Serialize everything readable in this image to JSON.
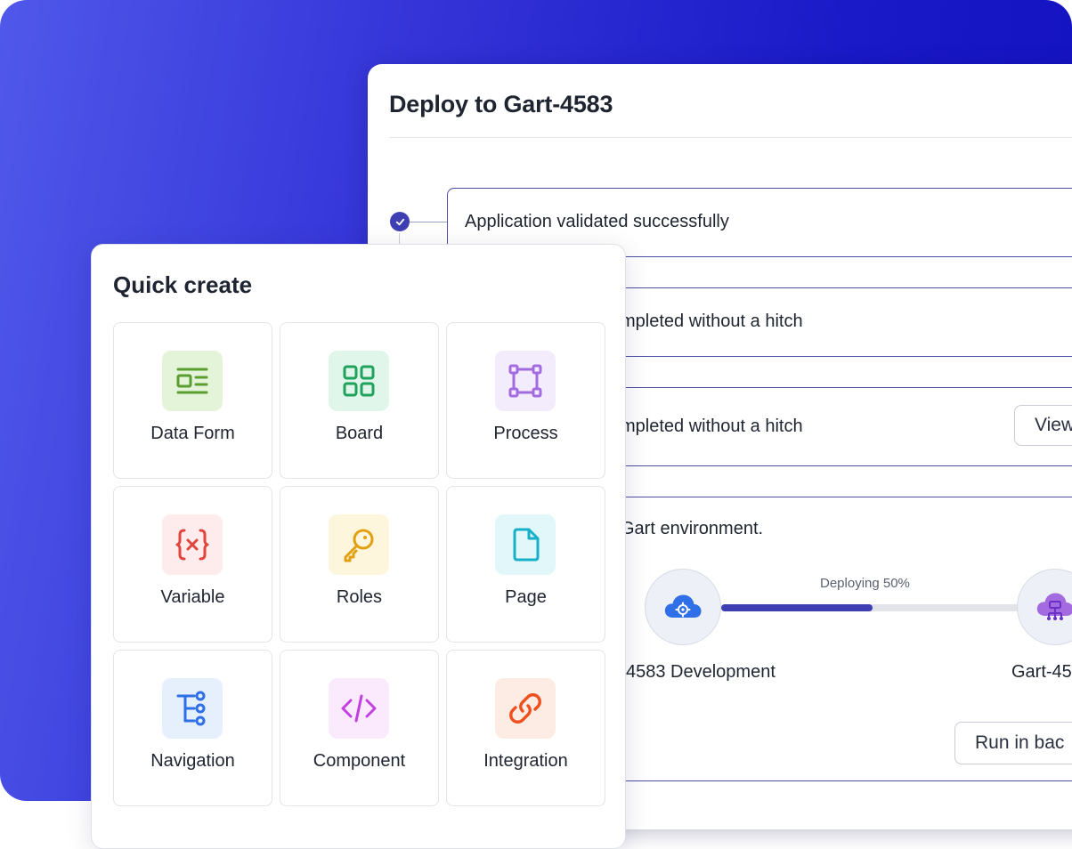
{
  "deploy": {
    "title": "Deploy to Gart-4583",
    "steps": [
      {
        "text": "Application validated successfully"
      },
      {
        "text": "mpleted without a hitch"
      },
      {
        "text": "mpleted without a hitch",
        "button": "View"
      },
      {
        "text": "Gart environment."
      }
    ],
    "progress": {
      "label": "Deploying 50%",
      "percent": 50
    },
    "source_label": "4583 Development",
    "target_label": "Gart-45",
    "run_button": "Run in bac"
  },
  "quick_create": {
    "title": "Quick create",
    "items": [
      {
        "label": "Data Form",
        "icon": "data-form-icon",
        "color": "#5a9e2f",
        "bg": "#e4f4d8"
      },
      {
        "label": "Board",
        "icon": "board-icon",
        "color": "#1fa35c",
        "bg": "#e0f6ea"
      },
      {
        "label": "Process",
        "icon": "process-icon",
        "color": "#a46be0",
        "bg": "#f3ecfc"
      },
      {
        "label": "Variable",
        "icon": "variable-icon",
        "color": "#e0443e",
        "bg": "#fdeceb"
      },
      {
        "label": "Roles",
        "icon": "key-icon",
        "color": "#e0a010",
        "bg": "#fdf6dc"
      },
      {
        "label": "Page",
        "icon": "page-icon",
        "color": "#18b0c8",
        "bg": "#e2f7fa"
      },
      {
        "label": "Navigation",
        "icon": "navigation-icon",
        "color": "#2f6fe8",
        "bg": "#e6effc"
      },
      {
        "label": "Component",
        "icon": "code-icon",
        "color": "#c040e0",
        "bg": "#fbeafd"
      },
      {
        "label": "Integration",
        "icon": "link-icon",
        "color": "#f0501e",
        "bg": "#fdece4"
      }
    ]
  },
  "colors": {
    "accent": "#3d3fb3",
    "bg_start": "#5058ea",
    "bg_end": "#1210bf"
  }
}
